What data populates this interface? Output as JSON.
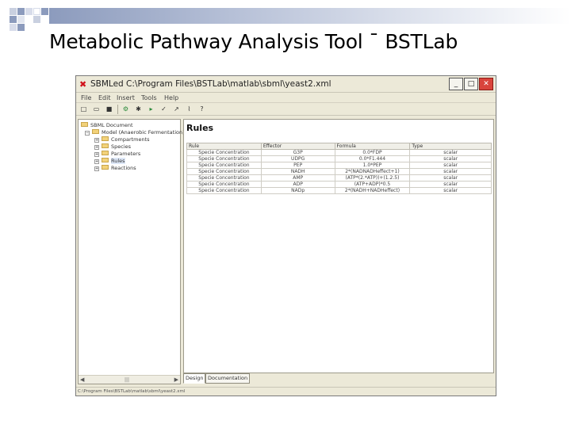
{
  "slide": {
    "title": "Metabolic Pathway Analysis Tool ¯ BSTLab",
    "accent_color": "#8c9bbd"
  },
  "window": {
    "title": "SBMLed C:\\Program Files\\BSTLab\\matlab\\sbml\\yeast2.xml",
    "app_icon": "close-x-icon",
    "buttons": {
      "minimize": "_",
      "maximize": "□",
      "close": "✕"
    }
  },
  "menu": [
    "File",
    "Edit",
    "Insert",
    "Tools",
    "Help"
  ],
  "tree": {
    "root": "SBML Document",
    "model": "Model (Anaerobic Fermentation)",
    "children": [
      "Compartments",
      "Species",
      "Parameters",
      "Rules",
      "Reactions"
    ],
    "selected": "Rules"
  },
  "content": {
    "heading": "Rules",
    "columns": [
      "Rule",
      "Effector",
      "Formula",
      "Type"
    ],
    "rows": [
      [
        "Specie Concentration",
        "G3P",
        "0.0*FDP",
        "scalar"
      ],
      [
        "Specie Concentration",
        "UDPG",
        "0.0*F1.444",
        "scalar"
      ],
      [
        "Specie Concentration",
        "PEP",
        "1.0*PEP",
        "scalar"
      ],
      [
        "Specie Concentration",
        "NADH",
        "2*(NADNADHeffect+1)",
        "scalar"
      ],
      [
        "Specie Concentration",
        "AMP",
        "(ATP*(2.*ATP))+(1.2.5)",
        "scalar"
      ],
      [
        "Specie Concentration",
        "ADP",
        "(ATP+ADP)*0.5",
        "scalar"
      ],
      [
        "Specie Concentration",
        "NADp",
        "2*(NADH+NADHeffect)",
        "scalar"
      ]
    ]
  },
  "tabs": [
    "Design",
    "Documentation"
  ],
  "status": "C:\\Program Files\\BSTLab\\matlab\\sbml\\yeast2.xml"
}
